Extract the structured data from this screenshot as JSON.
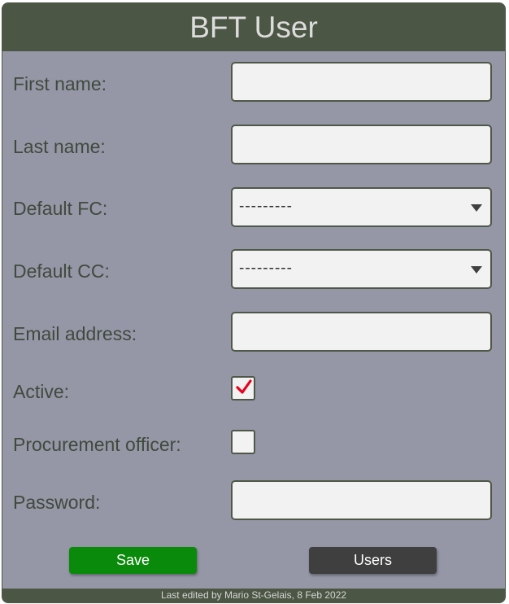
{
  "header": {
    "title": "BFT User"
  },
  "form": {
    "first_name": {
      "label": "First name:",
      "value": ""
    },
    "last_name": {
      "label": "Last name:",
      "value": ""
    },
    "default_fc": {
      "label": "Default FC:",
      "selected": "---------"
    },
    "default_cc": {
      "label": "Default CC:",
      "selected": "---------"
    },
    "email": {
      "label": "Email address:",
      "value": ""
    },
    "active": {
      "label": "Active:",
      "checked": true
    },
    "procurement_officer": {
      "label": "Procurement officer:",
      "checked": false
    },
    "password": {
      "label": "Password:",
      "value": ""
    }
  },
  "buttons": {
    "save_label": "Save",
    "users_label": "Users"
  },
  "footer": {
    "text": "Last edited by Mario St-Gelais, 8 Feb 2022"
  },
  "colors": {
    "header_bg": "#4c5644",
    "card_bg": "#9597a7",
    "save_bg": "#0a8a0a",
    "users_bg": "#3f3f3f",
    "check_color": "#e8001c"
  },
  "icons": {
    "checkbox_checked": "checkmark-icon",
    "select": "chevron-down-icon"
  }
}
